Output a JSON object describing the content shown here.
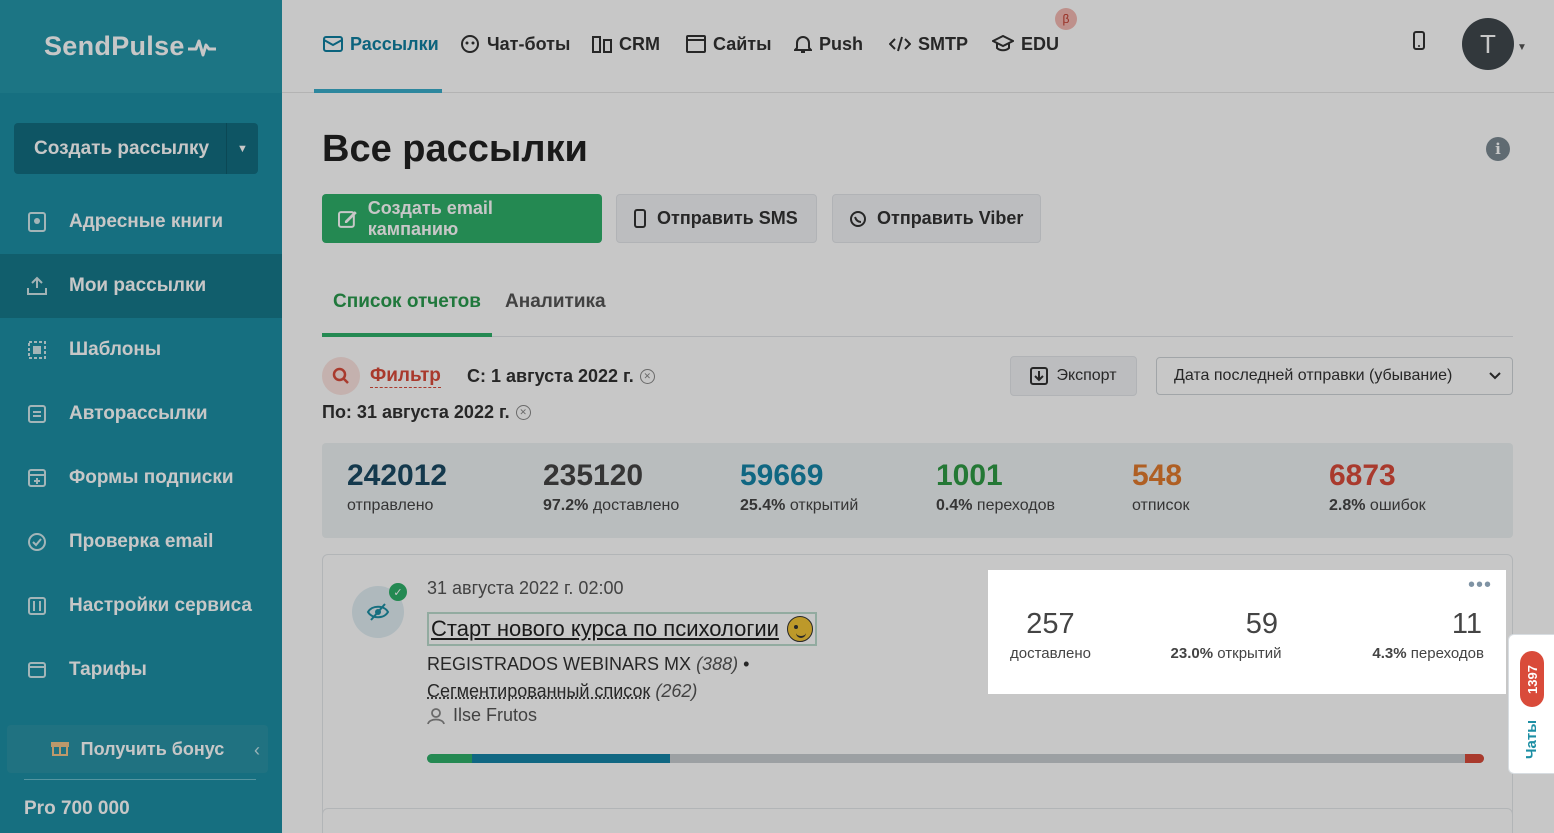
{
  "brand": {
    "logo_text": "SendPulse"
  },
  "sidebar": {
    "create_button": "Создать рассылку",
    "items": [
      {
        "label": "Адресные книги",
        "icon": "address-book-icon"
      },
      {
        "label": "Мои рассылки",
        "icon": "outbox-icon",
        "active": true
      },
      {
        "label": "Шаблоны",
        "icon": "template-icon"
      },
      {
        "label": "Авторассылки",
        "icon": "automation-icon"
      },
      {
        "label": "Формы подписки",
        "icon": "form-icon"
      },
      {
        "label": "Проверка email",
        "icon": "check-email-icon"
      },
      {
        "label": "Настройки сервиса",
        "icon": "settings-icon"
      },
      {
        "label": "Тарифы",
        "icon": "wallet-icon"
      }
    ],
    "bonus": "Получить бонус",
    "tariff": "Pro 700 000"
  },
  "topnav": {
    "items": [
      {
        "label": "Рассылки",
        "icon": "mail-icon",
        "active": true
      },
      {
        "label": "Чат-боты",
        "icon": "chatbot-icon"
      },
      {
        "label": "CRM",
        "icon": "crm-icon"
      },
      {
        "label": "Сайты",
        "icon": "sites-icon"
      },
      {
        "label": "Push",
        "icon": "bell-icon"
      },
      {
        "label": "SMTP",
        "icon": "code-icon"
      },
      {
        "label": "EDU",
        "icon": "graduation-cap-icon"
      }
    ],
    "beta": "β",
    "avatar": "T"
  },
  "page": {
    "title": "Все рассылки",
    "buttons": {
      "create_email": "Создать email кампанию",
      "send_sms": "Отправить SMS",
      "send_viber": "Отправить Viber"
    },
    "tabs": [
      "Список отчетов",
      "Аналитика"
    ],
    "filter": {
      "label": "Фильтр",
      "from": "С: 1 августа 2022 г.",
      "to": "По: 31 августа 2022 г."
    },
    "export": "Экспорт",
    "sort": "Дата последней отправки (убывание)"
  },
  "stats": [
    {
      "num": "242012",
      "pct": "",
      "label": "отправлено",
      "color": "#1a4a63"
    },
    {
      "num": "235120",
      "pct": "97.2%",
      "label": "доставлено",
      "color": "#444444"
    },
    {
      "num": "59669",
      "pct": "25.4%",
      "label": "открытий",
      "color": "#1584a7"
    },
    {
      "num": "1001",
      "pct": "0.4%",
      "label": "переходов",
      "color": "#2f9a44"
    },
    {
      "num": "548",
      "pct": "",
      "label": "отписок",
      "color": "#e07a2e"
    },
    {
      "num": "6873",
      "pct": "2.8%",
      "label": "ошибок",
      "color": "#d94b3a"
    }
  ],
  "campaign": {
    "date": "31 августа 2022 г. 02:00",
    "title": "Старт нового курса по психологии",
    "list_name": "REGISTRADOS WEBINARS MX",
    "list_count": "(388)",
    "segment": "Сегментированный список",
    "segment_count": "(262)",
    "author": "Ilse Frutos",
    "progress": {
      "green": 0.043,
      "blue": 0.187,
      "gray": 0.752,
      "red": 0.018
    },
    "metrics": [
      {
        "num": "257",
        "pct": "",
        "label": "доставлено"
      },
      {
        "num": "59",
        "pct": "23.0%",
        "label": "открытий"
      },
      {
        "num": "11",
        "pct": "4.3%",
        "label": "переходов"
      }
    ]
  },
  "chat": {
    "badge": "1397",
    "label": "Чаты"
  }
}
